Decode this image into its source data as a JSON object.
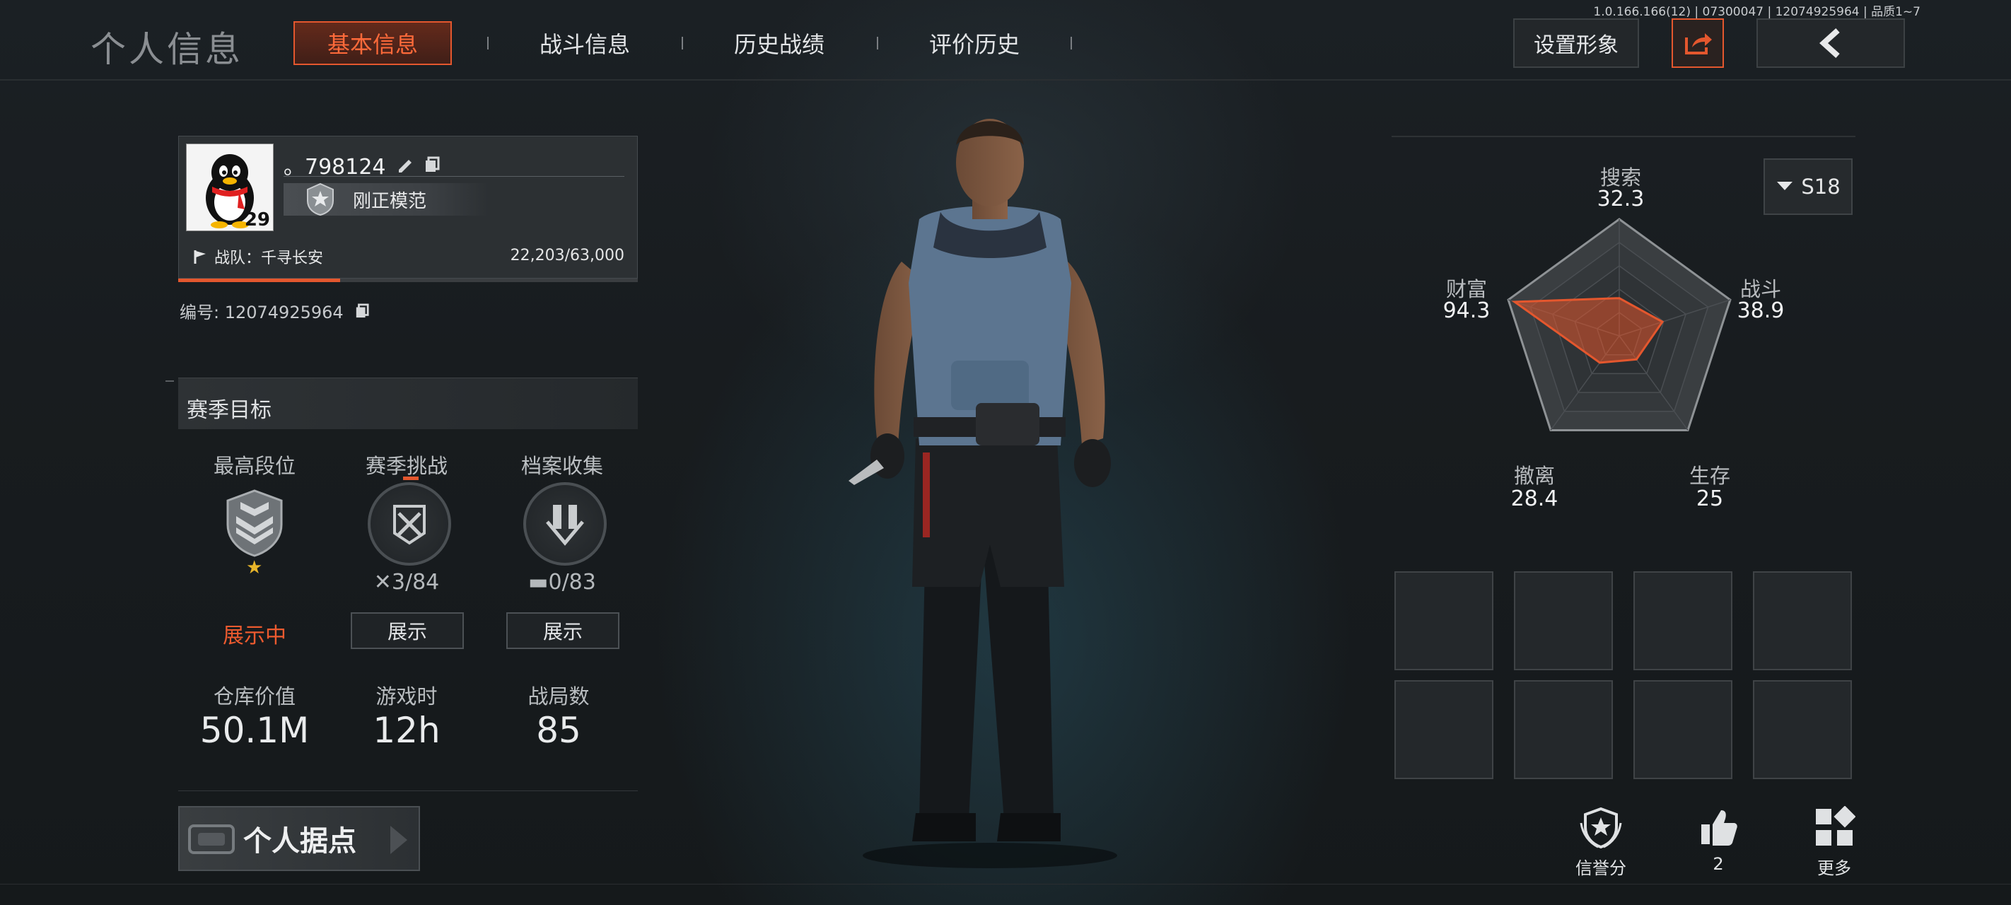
{
  "header": {
    "page_title": "个人信息",
    "tabs": [
      {
        "label": "基本信息",
        "active": true
      },
      {
        "label": "战斗信息",
        "active": false
      },
      {
        "label": "历史战绩",
        "active": false
      },
      {
        "label": "评价历史",
        "active": false
      }
    ],
    "set_appearance_label": "设置形象",
    "version_text": "1.0.166.166(12) | 07300047 | 12074925964 | 品质1~7"
  },
  "profile": {
    "name": "。798124",
    "level": "29",
    "title": "刚正模范",
    "team_label": "战队：千寻长安",
    "exp_text": "22,203/63,000",
    "exp_progress": 0.352,
    "id_label": "编号: 12074925964"
  },
  "season_goals": {
    "title": "赛季目标",
    "items": [
      {
        "label": "最高段位",
        "count": "",
        "action": "展示中"
      },
      {
        "label": "赛季挑战",
        "count": "3/84",
        "action": "展示"
      },
      {
        "label": "档案收集",
        "count": "0/83",
        "action": "展示"
      }
    ]
  },
  "stats": [
    {
      "label": "仓库价值",
      "value": "50.1M"
    },
    {
      "label": "游戏时",
      "value": "12h"
    },
    {
      "label": "战局数",
      "value": "85"
    }
  ],
  "base_button_label": "个人据点",
  "season_select": "S18",
  "radar": {
    "axes": [
      {
        "label": "搜索",
        "value": "32.3",
        "score": 0.323
      },
      {
        "label": "战斗",
        "value": "38.9",
        "score": 0.389
      },
      {
        "label": "生存",
        "value": "25",
        "score": 0.25
      },
      {
        "label": "撤离",
        "value": "28.4",
        "score": 0.284
      },
      {
        "label": "财富",
        "value": "94.3",
        "score": 0.943
      }
    ],
    "accent_color": "#e4572e"
  },
  "bottom_actions": [
    {
      "label": "信誉分",
      "icon": "reputation-shield-icon"
    },
    {
      "label": "2",
      "icon": "thumbs-up-icon"
    },
    {
      "label": "更多",
      "icon": "more-grid-icon"
    }
  ],
  "colors": {
    "accent": "#e4572e",
    "background": "#181c1f"
  }
}
